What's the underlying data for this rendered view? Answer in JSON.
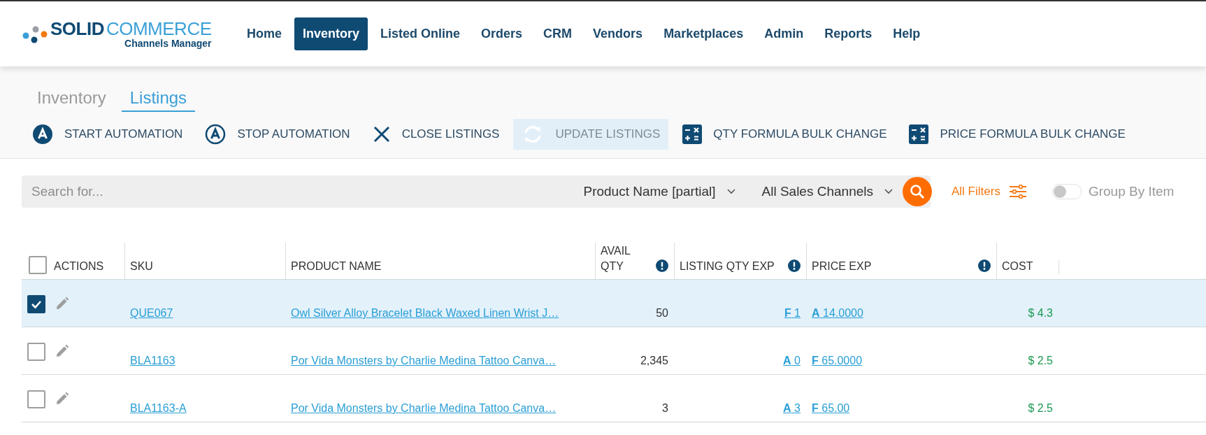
{
  "logo": {
    "brand_bold": "SOLID",
    "brand_light": "COMMERCE",
    "subtitle": "Channels Manager"
  },
  "nav": [
    {
      "label": "Home",
      "selected": false
    },
    {
      "label": "Inventory",
      "selected": true
    },
    {
      "label": "Listed Online",
      "selected": false
    },
    {
      "label": "Orders",
      "selected": false
    },
    {
      "label": "CRM",
      "selected": false
    },
    {
      "label": "Vendors",
      "selected": false
    },
    {
      "label": "Marketplaces",
      "selected": false
    },
    {
      "label": "Admin",
      "selected": false
    },
    {
      "label": "Reports",
      "selected": false
    },
    {
      "label": "Help",
      "selected": false
    }
  ],
  "subtabs": [
    {
      "label": "Inventory",
      "selected": false
    },
    {
      "label": "Listings",
      "selected": true
    }
  ],
  "toolbar": [
    {
      "kind": "start",
      "label": "START AUTOMATION",
      "highlighted": false
    },
    {
      "kind": "stop",
      "label": "STOP AUTOMATION",
      "highlighted": false
    },
    {
      "kind": "close",
      "label": "CLOSE LISTINGS",
      "highlighted": false
    },
    {
      "kind": "update",
      "label": "UPDATE LISTINGS",
      "highlighted": true
    },
    {
      "kind": "formula",
      "label": "QTY FORMULA BULK CHANGE",
      "highlighted": false
    },
    {
      "kind": "formula",
      "label": "PRICE FORMULA BULK CHANGE",
      "highlighted": false
    }
  ],
  "search": {
    "placeholder": "Search for...",
    "field_dropdown": "Product Name [partial]",
    "channel_dropdown": "All Sales Channels"
  },
  "all_filters": "All Filters",
  "group_by_item": {
    "label": "Group By Item",
    "on": false
  },
  "table": {
    "select_all_checked": false,
    "columns": [
      {
        "label": "ACTIONS",
        "info": false
      },
      {
        "label": "SKU",
        "info": false
      },
      {
        "label": "PRODUCT NAME",
        "info": false
      },
      {
        "label": "AVAIL QTY",
        "info": true
      },
      {
        "label": "LISTING QTY EXP",
        "info": true
      },
      {
        "label": "PRICE EXP",
        "info": true
      },
      {
        "label": "COST",
        "info": false
      }
    ],
    "rows": [
      {
        "selected": true,
        "sku": "QUE067",
        "product_name": "Owl Silver Alloy Bracelet Black Waxed Linen Wrist J…",
        "avail_qty": "50",
        "listing_qty_exp": "**F** 1",
        "price_exp": "**A** 14.0000",
        "cost": "$ 4.3"
      },
      {
        "selected": false,
        "sku": "BLA1163",
        "product_name": "Por Vida Monsters by Charlie Medina Tattoo Canva…",
        "avail_qty": "2,345",
        "listing_qty_exp": "**A** 0",
        "price_exp": "**F** 65.0000",
        "cost": "$ 2.5"
      },
      {
        "selected": false,
        "sku": "BLA1163-A",
        "product_name": "Por Vida Monsters by Charlie Medina Tattoo Canva…",
        "avail_qty": "3",
        "listing_qty_exp": "**A** 3",
        "price_exp": "**F** 65.00",
        "cost": "$ 2.5"
      }
    ]
  }
}
